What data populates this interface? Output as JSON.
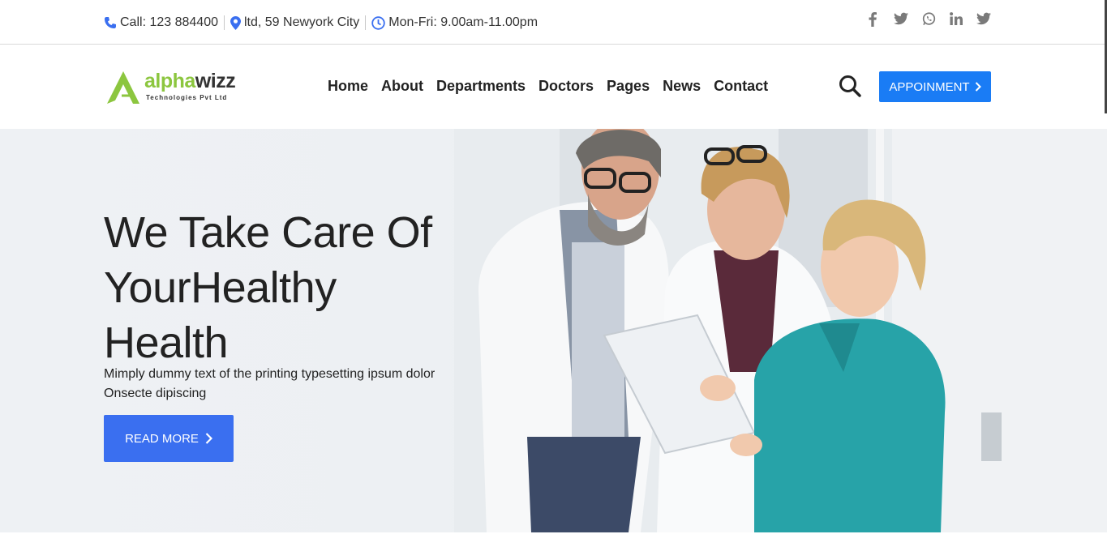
{
  "topbar": {
    "phone": "Call: 123 884400",
    "address": "ltd, 59 Newyork City",
    "hours": "Mon-Fri: 9.00am-11.00pm",
    "social": [
      "facebook-icon",
      "twitter-icon",
      "whatsapp-icon",
      "linkedin-icon",
      "twitter-icon"
    ]
  },
  "logo": {
    "name_part1": "alpha",
    "name_part2": "wizz",
    "tagline": "Technologies Pvt Ltd"
  },
  "nav": {
    "items": [
      "Home",
      "About",
      "Departments",
      "Doctors",
      "Pages",
      "News",
      "Contact"
    ]
  },
  "header": {
    "appointment_label": "APPOINMENT"
  },
  "hero": {
    "headline_line1": "We Take Care Of",
    "headline_line2": "YourHealthy",
    "headline_line3": "Health",
    "subtitle_line1": "Mimply dummy text of the printing typesetting ipsum dolor",
    "subtitle_line2": "Onsecte dipiscing",
    "button_label": "READ MORE"
  },
  "colors": {
    "accent": "#1a7cf5",
    "button": "#3a6ff0",
    "logo_green": "#8cc63f",
    "icon_blue": "#3a6ff0"
  }
}
